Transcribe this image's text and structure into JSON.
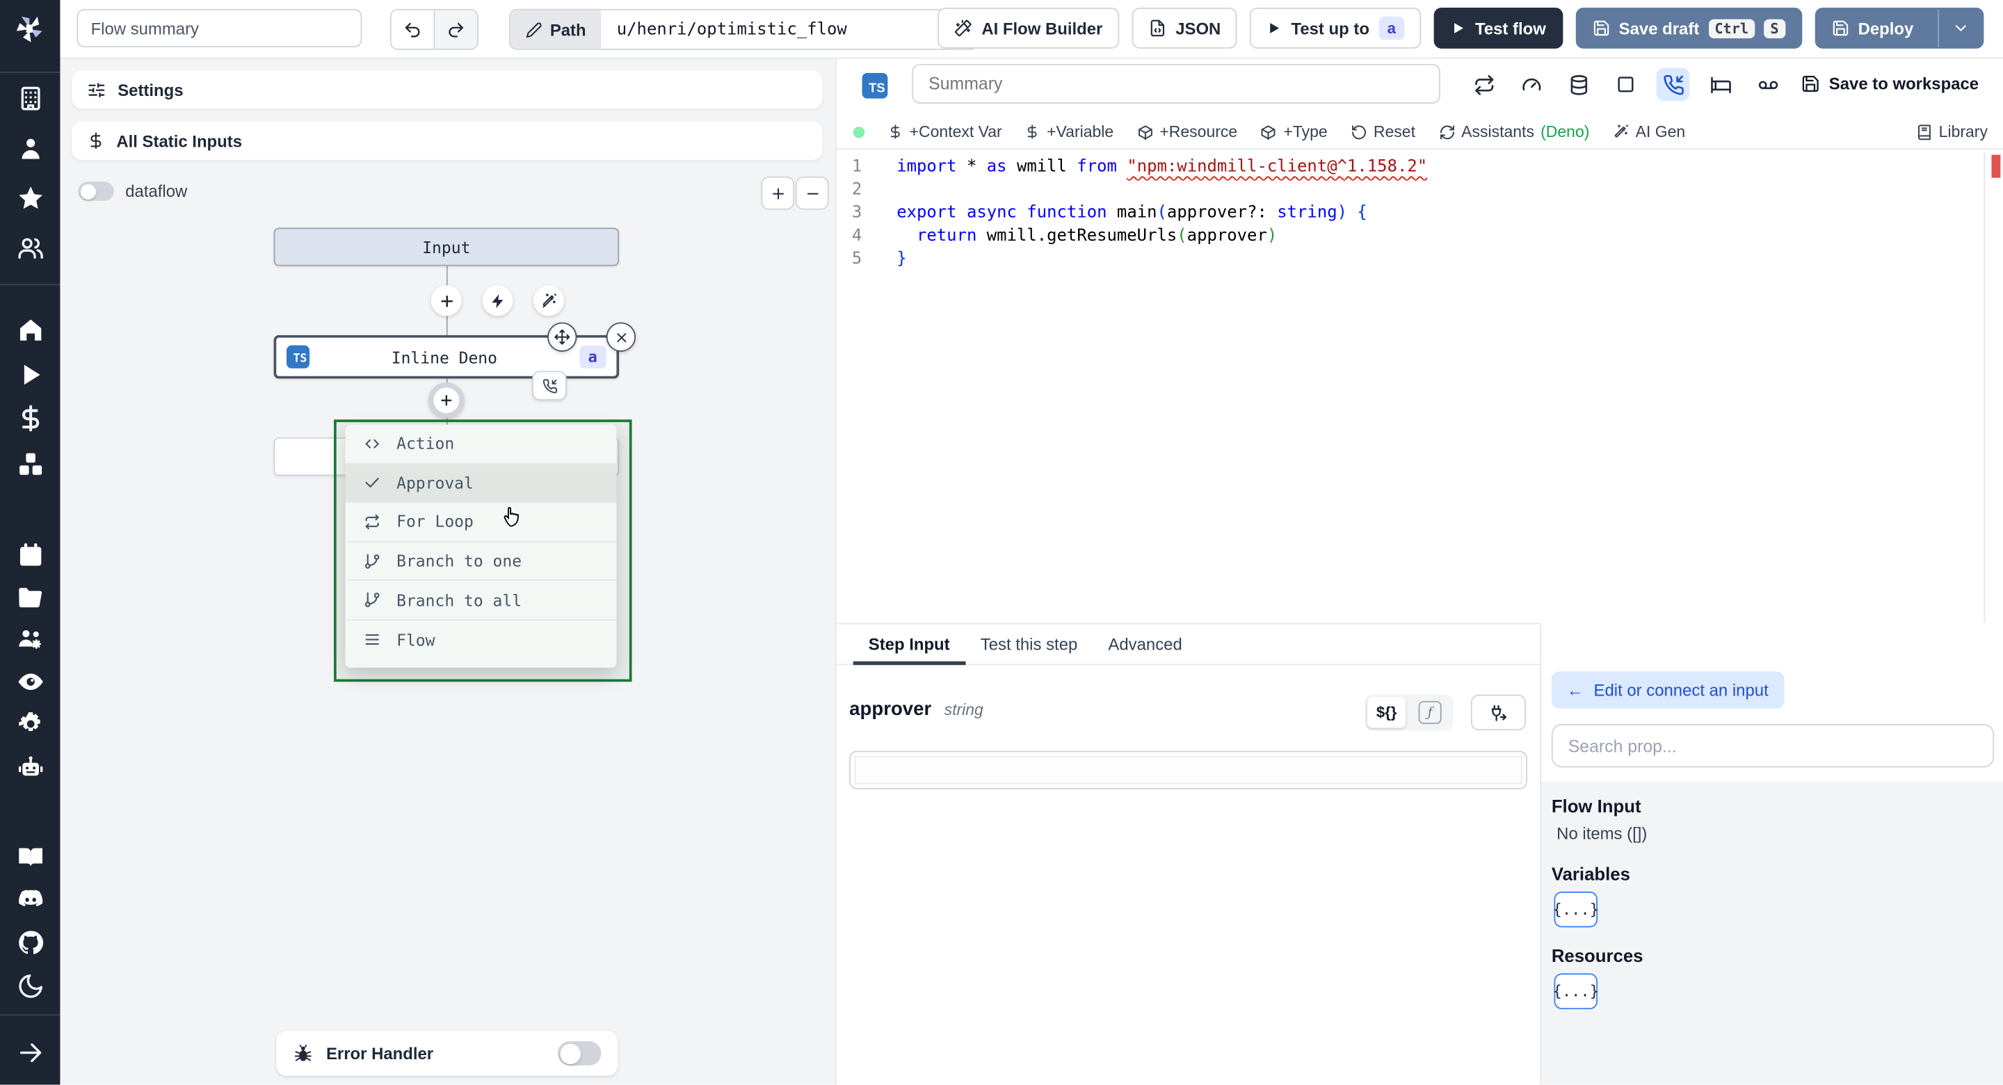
{
  "topbar": {
    "flow_summary_placeholder": "Flow summary",
    "path_label": "Path",
    "path_value": "u/henri/optimistic_flow",
    "ai_flow_builder": "AI Flow Builder",
    "json_label": "JSON",
    "test_up_to": "Test up to",
    "test_up_to_badge": "a",
    "test_flow": "Test flow",
    "save_draft": "Save draft",
    "kbd_ctrl": "Ctrl",
    "kbd_s": "S",
    "deploy": "Deploy"
  },
  "canvas": {
    "settings": "Settings",
    "static_inputs": "All Static Inputs",
    "dataflow": "dataflow",
    "input_node": "Input",
    "step_node": "Inline Deno",
    "step_node_lang_badge": "TS",
    "step_node_id_badge": "a",
    "menu": {
      "items": [
        {
          "icon": "code",
          "label": "Action",
          "hover": false
        },
        {
          "icon": "check",
          "label": "Approval",
          "hover": true
        },
        {
          "icon": "repeat",
          "label": "For Loop",
          "hover": false
        },
        {
          "icon": "branch",
          "label": "Branch to one",
          "hover": false
        },
        {
          "icon": "branch",
          "label": "Branch to all",
          "hover": false
        },
        {
          "icon": "list",
          "label": "Flow",
          "hover": false
        }
      ]
    },
    "error_handler": "Error Handler"
  },
  "editor": {
    "lang_badge": "TS",
    "summary_placeholder": "Summary",
    "save_to_workspace": "Save to workspace",
    "toolbar": {
      "context_var": "+Context Var",
      "variable": "+Variable",
      "resource": "+Resource",
      "type": "+Type",
      "reset": "Reset",
      "assistants": "Assistants",
      "assistants_lang": "(Deno)",
      "ai_gen": "AI Gen",
      "library": "Library"
    },
    "code_lines": [
      {
        "n": "1",
        "seg": [
          [
            "tk-kw",
            "import"
          ],
          [
            "tk-pl",
            " * "
          ],
          [
            "tk-kw",
            "as"
          ],
          [
            "tk-pl",
            " wmill "
          ],
          [
            "tk-kw",
            "from"
          ],
          [
            "tk-pl",
            " "
          ],
          [
            "tk-str",
            "\"npm:windmill-client@^1.158.2\""
          ]
        ]
      },
      {
        "n": "2",
        "seg": []
      },
      {
        "n": "3",
        "seg": [
          [
            "tk-kw",
            "export"
          ],
          [
            "tk-pl",
            " "
          ],
          [
            "tk-kw",
            "async"
          ],
          [
            "tk-pl",
            " "
          ],
          [
            "tk-kw",
            "function"
          ],
          [
            "tk-pl",
            " main"
          ],
          [
            "tk-b1",
            "("
          ],
          [
            "tk-pl",
            "approver?: "
          ],
          [
            "tk-kw",
            "string"
          ],
          [
            "tk-b1",
            ")"
          ],
          [
            "tk-pl",
            " "
          ],
          [
            "tk-b1",
            "{"
          ]
        ]
      },
      {
        "n": "4",
        "seg": [
          [
            "tk-pl",
            "  "
          ],
          [
            "tk-kw",
            "return"
          ],
          [
            "tk-pl",
            " wmill.getResumeUrls"
          ],
          [
            "tk-b2",
            "("
          ],
          [
            "tk-pl",
            "approver"
          ],
          [
            "tk-b2",
            ")"
          ]
        ]
      },
      {
        "n": "5",
        "seg": [
          [
            "tk-b1",
            "}"
          ]
        ]
      }
    ]
  },
  "tabs": {
    "step_input": "Step Input",
    "test_this_step": "Test this step",
    "advanced": "Advanced"
  },
  "step": {
    "arg_name": "approver",
    "arg_type": "string",
    "template_toggle": "${}",
    "fx_toggle": "ƒ"
  },
  "prop_panel": {
    "back_arrow": "←",
    "edit_connect": "Edit or connect an input",
    "search_placeholder": "Search prop...",
    "flow_input": "Flow Input",
    "no_items": "No items ([])",
    "variables": "Variables",
    "resources": "Resources",
    "braces": "{...}"
  },
  "colors": {
    "sidebar_bg": "#1d2432",
    "steel_button": "#5f7a9e",
    "dark_button": "#242e3f",
    "ts_badge": "#3178c6",
    "menu_border_green": "#1e7a36",
    "deno_green": "#16a34a",
    "indigo_badge_bg": "#e0e7ff",
    "error_marker_red": "#e05252",
    "active_icon_bg": "#dbeafe"
  }
}
